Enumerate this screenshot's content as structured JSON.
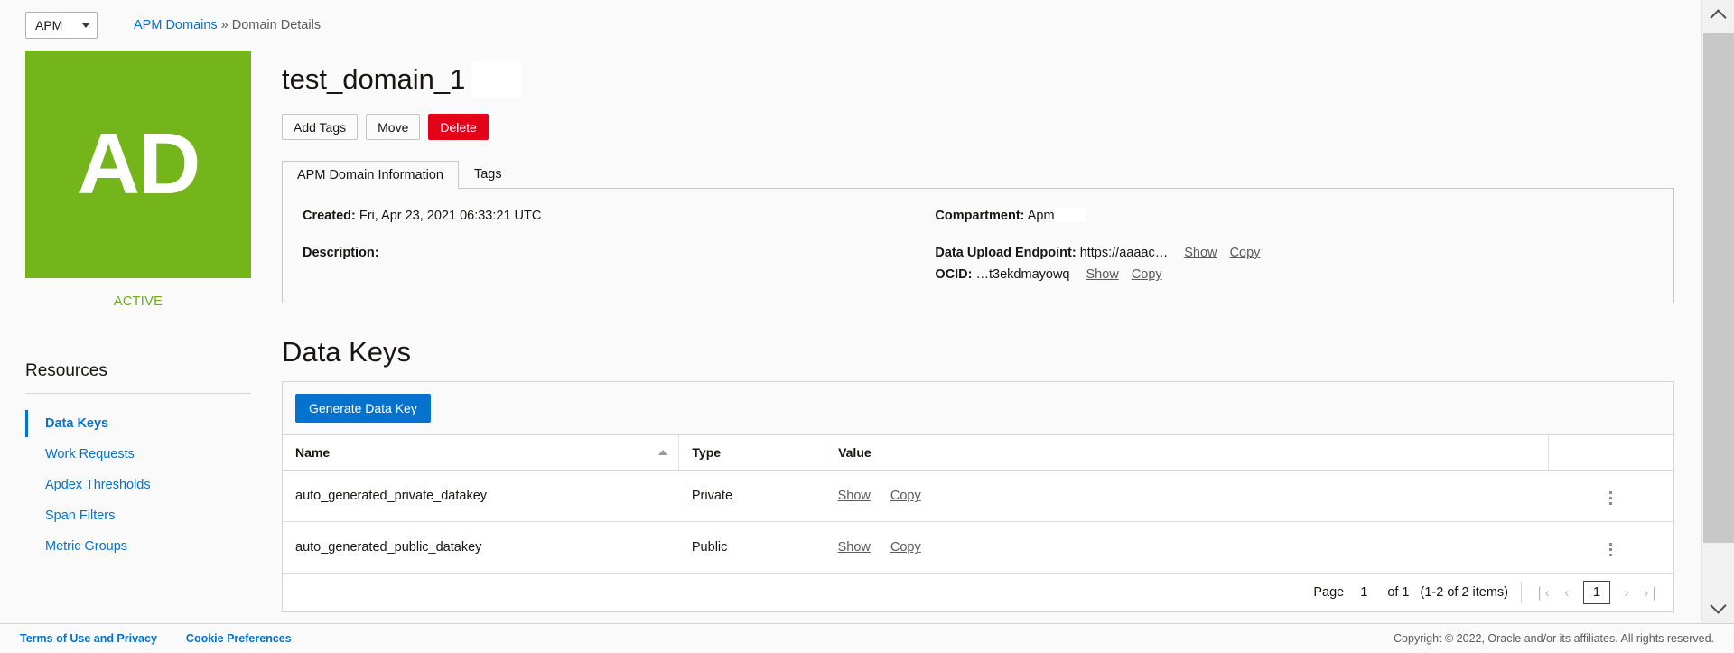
{
  "topbar": {
    "service_selector": {
      "value": "APM",
      "icon": "chevron-down-icon"
    },
    "breadcrumb": {
      "root_link": "APM Domains",
      "separator": "»",
      "current": "Domain Details"
    }
  },
  "identity": {
    "avatar_initials": "AD",
    "avatar_color": "#75b51c",
    "lifecycle_state": "ACTIVE",
    "lifecycle_color": "#6aad17"
  },
  "resources": {
    "title": "Resources",
    "items": [
      {
        "label": "Data Keys",
        "active": true
      },
      {
        "label": "Work Requests",
        "active": false
      },
      {
        "label": "Apdex Thresholds",
        "active": false
      },
      {
        "label": "Span Filters",
        "active": false
      },
      {
        "label": "Metric Groups",
        "active": false
      }
    ]
  },
  "page": {
    "title": "test_domain_1"
  },
  "actions": {
    "add_tags": "Add Tags",
    "move": "Move",
    "delete": "Delete",
    "delete_color": "#e5001a"
  },
  "tabs": [
    {
      "label": "APM Domain Information",
      "selected": true
    },
    {
      "label": "Tags",
      "selected": false
    }
  ],
  "info": {
    "created_label": "Created:",
    "created_value": "Fri, Apr 23, 2021 06:33:21 UTC",
    "description_label": "Description:",
    "description_value": "",
    "compartment_label": "Compartment:",
    "compartment_value": "Apm",
    "endpoint_label": "Data Upload Endpoint:",
    "endpoint_value": "https://aaaac…",
    "endpoint_show": "Show",
    "endpoint_copy": "Copy",
    "ocid_label": "OCID:",
    "ocid_value": "…t3ekdmayowq",
    "ocid_show": "Show",
    "ocid_copy": "Copy"
  },
  "datakeys": {
    "heading": "Data Keys",
    "generate_button": "Generate Data Key",
    "generate_button_color": "#0572ce",
    "columns": [
      "Name",
      "Type",
      "Value",
      ""
    ],
    "sorted_column": "Name",
    "sort_direction": "asc",
    "rows": [
      {
        "name": "auto_generated_private_datakey",
        "type": "Private",
        "show": "Show",
        "copy": "Copy",
        "menu_icon": "kebab-menu-icon"
      },
      {
        "name": "auto_generated_public_datakey",
        "type": "Public",
        "show": "Show",
        "copy": "Copy",
        "menu_icon": "kebab-menu-icon"
      }
    ],
    "pagination": {
      "page_label": "Page",
      "page_number": "1",
      "of_label": "of 1",
      "items_label": "(1-2 of 2 items)",
      "first_icon": "❘‹",
      "prev_icon": "‹",
      "current_page_input": "1",
      "next_icon": "›",
      "last_icon": "›❘"
    }
  },
  "footer": {
    "terms_link": "Terms of Use and Privacy",
    "cookie_link": "Cookie Preferences",
    "copyright": "Copyright © 2022, Oracle and/or its affiliates. All rights reserved."
  },
  "scrollbar": {
    "up_icon": "chevron-up-icon",
    "down_icon": "chevron-down-icon"
  }
}
